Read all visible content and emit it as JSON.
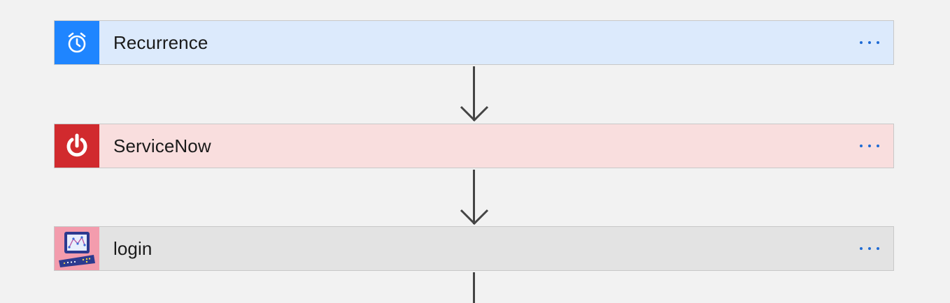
{
  "steps": [
    {
      "title": "Recurrence",
      "icon": "alarm-clock-icon",
      "accent": "#1f85ff",
      "background": "#dceafc"
    },
    {
      "title": "ServiceNow",
      "icon": "power-icon",
      "accent": "#d12a2e",
      "background": "#f9dede"
    },
    {
      "title": "login",
      "icon": "custom-computer-icon",
      "accent": "#f39cad",
      "background": "#e3e3e3"
    }
  ],
  "more_menu_icon": "ellipsis-icon",
  "colors": {
    "canvas": "#f2f2f2",
    "connector": "#444444",
    "ellipsis": "#1f6bd4"
  }
}
